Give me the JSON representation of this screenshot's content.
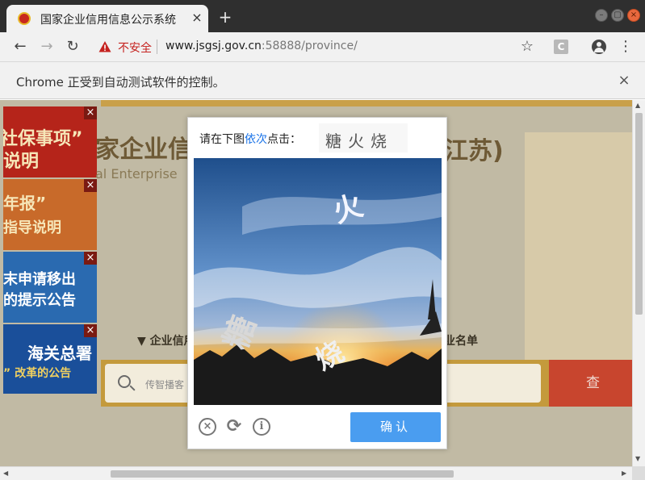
{
  "browser": {
    "tab_title": "国家企业信用信息公示系统",
    "tab_close": "×",
    "new_tab": "+",
    "security_label": "不安全",
    "url_host": "www.jsgsj.gov.cn",
    "url_rest": ":58888/province/",
    "ext_label": "C",
    "automation_notice": "Chrome 正受到自动测试软件的控制。",
    "close_notice": "×"
  },
  "page": {
    "ads": [
      {
        "line1": "社保事项”",
        "line2": "说明"
      },
      {
        "line1": "年报”",
        "line2": "指导说明"
      },
      {
        "line1": "末申请移出",
        "line2": "的提示公告"
      },
      {
        "line1": "海关总署",
        "line2": "” 改革的公告"
      }
    ],
    "ad_close": "×",
    "banner_title": "家企业信",
    "banner_subtitle": "al Enterprise",
    "banner_right": "江苏)",
    "nav_left": "▼ 企业信用",
    "nav_right": "企业名单",
    "search_placeholder": "传智播客",
    "search_button": "查 询"
  },
  "captcha": {
    "prompt_before": "请在下图",
    "prompt_highlight": "依次",
    "prompt_after": "点击：",
    "target_chars": "糖火烧",
    "image_glyphs": [
      "火",
      "糖",
      "烧"
    ],
    "confirm_label": "确认",
    "close_symbol": "×",
    "refresh_symbol": "⟳",
    "info_symbol": "i"
  },
  "colors": {
    "accent_blue": "#4a9df0",
    "prompt_highlight": "#1a73e8",
    "insecure_red": "#c5221f"
  }
}
